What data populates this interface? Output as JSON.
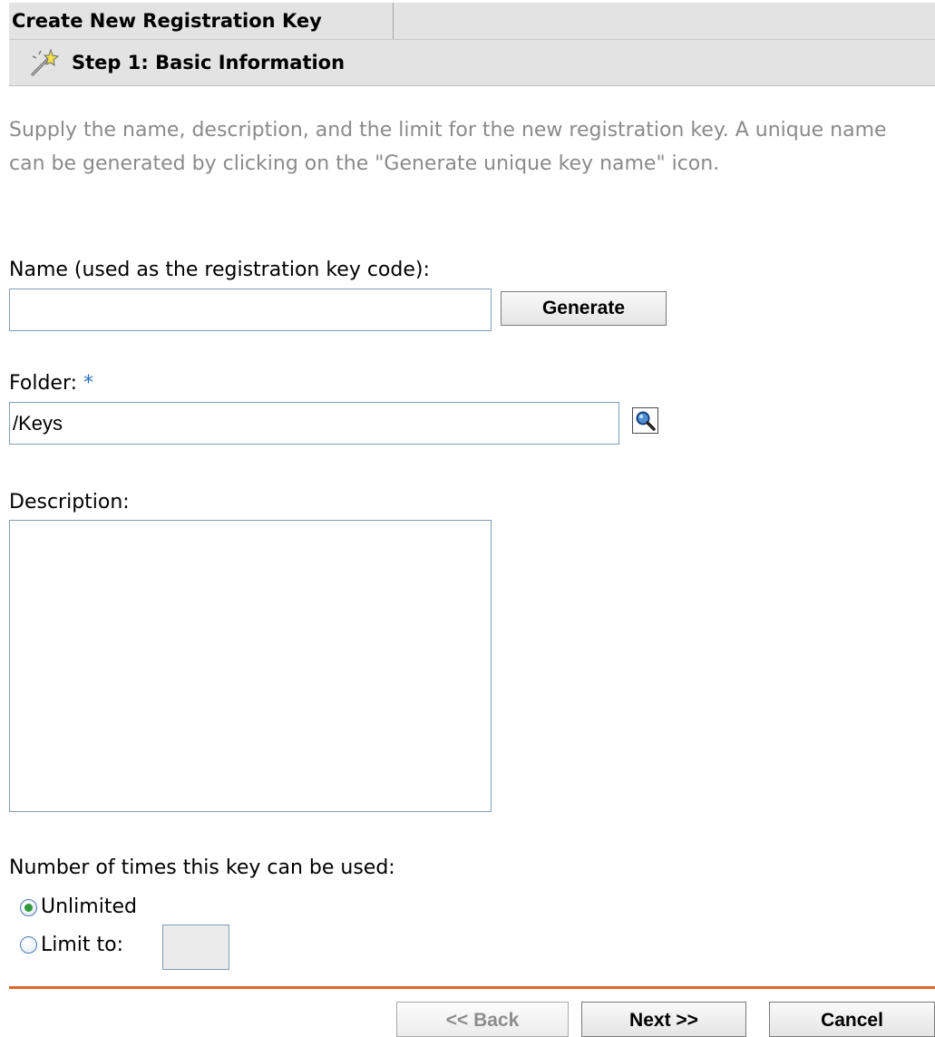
{
  "dialog": {
    "title": "Create New Registration Key",
    "step_title": "Step 1: Basic Information",
    "instructions": "Supply the name, description, and the limit for the new registration key. A unique name can be generated by clicking on the \"Generate unique key name\" icon."
  },
  "form": {
    "name_label": "Name (used as the registration key code):",
    "name_value": "",
    "generate_label": "Generate",
    "folder_label": "Folder:",
    "folder_required": "*",
    "folder_value": "/Keys",
    "browse_icon": "search-icon",
    "description_label": "Description:",
    "description_value": "",
    "usage_label": "Number of times this key can be used:",
    "usage_options": [
      {
        "label": "Unlimited",
        "checked": true
      },
      {
        "label": "Limit to:",
        "checked": false
      }
    ],
    "limit_value": ""
  },
  "footer": {
    "back_label": "<< Back",
    "next_label": "Next >>",
    "cancel_label": "Cancel"
  },
  "colors": {
    "header_bg": "#e3e3e3",
    "instruction_text": "#8a8a8a",
    "required_marker": "#2a6fbf",
    "divider": "#e0662a",
    "radio_checked": "#2f9a3a"
  }
}
